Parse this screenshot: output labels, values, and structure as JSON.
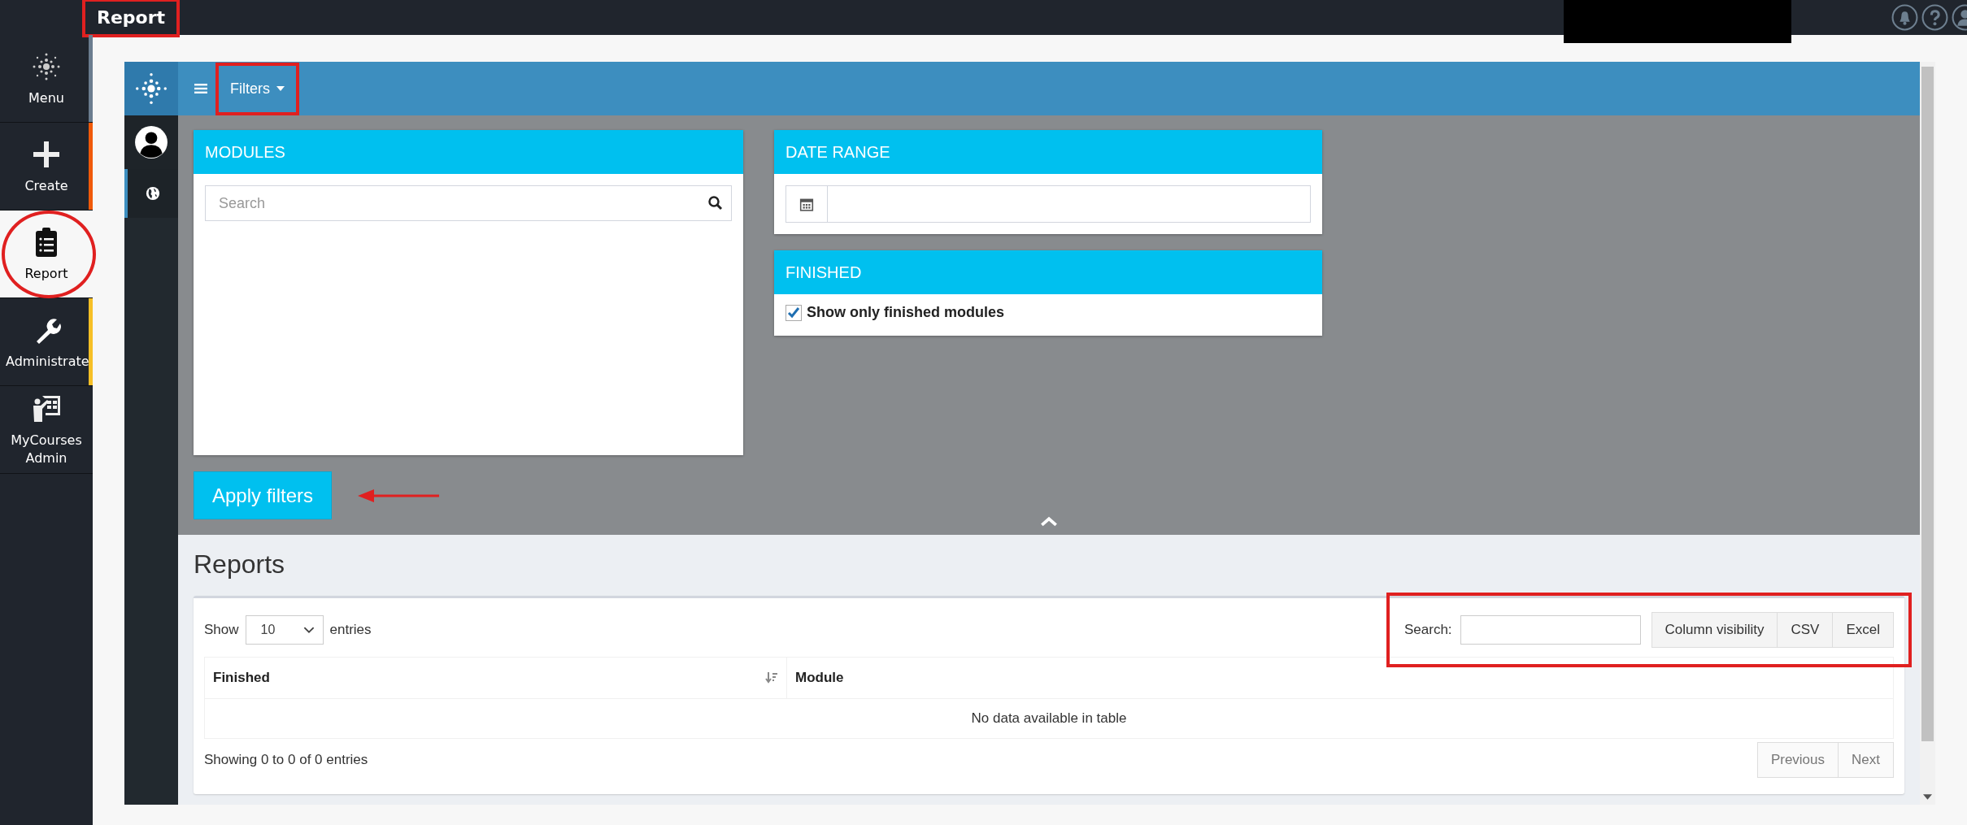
{
  "topbar": {
    "title": "Report"
  },
  "nav": [
    {
      "label": "Menu",
      "selected": false,
      "color": "#6b7d8f"
    },
    {
      "label": "Create",
      "selected": false,
      "color": "#f05a0a"
    },
    {
      "label": "Report",
      "selected": true
    },
    {
      "label": "Administrate",
      "selected": false,
      "color": "#f6bf26"
    },
    {
      "label": "MyCourses Admin",
      "selected": false
    }
  ],
  "app": {
    "menu": "Filters"
  },
  "filters": {
    "modules": {
      "title": "MODULES",
      "search": {
        "placeholder": "Search"
      }
    },
    "date_range": {
      "title": "DATE RANGE"
    },
    "finished": {
      "title": "FINISHED",
      "checkbox": {
        "label": "Show only finished modules",
        "checked": true
      }
    },
    "apply": "Apply filters"
  },
  "reports": {
    "title": "Reports",
    "length": {
      "before": "Show",
      "value": "10",
      "after": "entries"
    },
    "search": {
      "label": "Search:"
    },
    "buttons": [
      "Column visibility",
      "CSV",
      "Excel"
    ],
    "table": {
      "columns": [
        {
          "label": "Finished",
          "sorted": true
        },
        {
          "label": "Module",
          "sorted": false
        }
      ],
      "empty": "No data available in table"
    },
    "info": "Showing 0 to 0 of 0 entries",
    "pagination": [
      {
        "label": "Previous",
        "disabled": true
      },
      {
        "label": "Next",
        "disabled": true
      }
    ]
  }
}
